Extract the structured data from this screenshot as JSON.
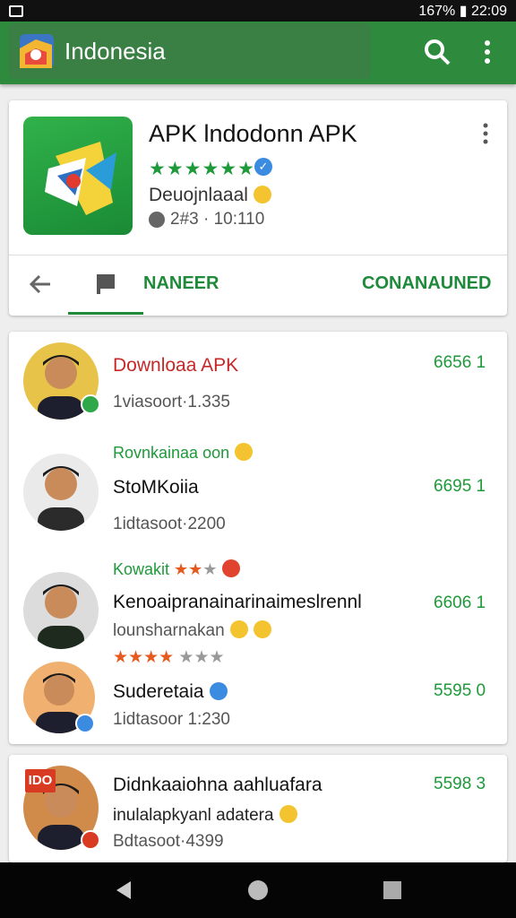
{
  "status_bar": {
    "right_text": "167% ▮ 22:09"
  },
  "app_bar": {
    "title": "Indonesia",
    "colors": {
      "primary": "#2e8b3e"
    }
  },
  "app_card": {
    "title": "APK lndodonn APK",
    "stars": "★★★★★★",
    "download_label": "Deuojnlaaal",
    "meta": "2#3 · 10:110",
    "tabs": {
      "active": "NANEER",
      "right": "CONANAUNED"
    }
  },
  "list": [
    {
      "title": "Downloaa APK",
      "sub": "1viasoort·1.335",
      "num": "6656 1"
    },
    {
      "green_label": "Rovnkainaa oon",
      "title": "StoMKoiia",
      "sub": "1idtasoot·2200",
      "num": "6695 1"
    },
    {
      "green_label": "Kowakit",
      "title": "Kenoaipranainarinaimeslrennl",
      "sub": "lounsharnakan",
      "num": "6606 1",
      "stars": "★★★★",
      "grey_stars": "★★★"
    },
    {
      "title": "Suderetaia",
      "sub": "1idtasoor 1:230",
      "num": "5595 0"
    }
  ],
  "list2": {
    "title": "Didnkaaiohna aahluafara",
    "sub1": "inulalapkyanl adatera",
    "sub2": "Bdtasoot·4399",
    "num": "5598 3",
    "avatar_badge": "IDO"
  }
}
